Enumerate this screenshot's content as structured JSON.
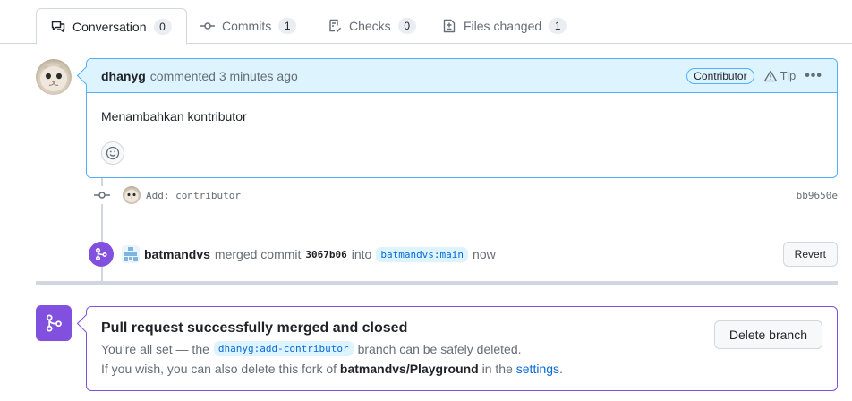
{
  "tabs": [
    {
      "label": "Conversation",
      "count": "0",
      "icon": "comment-discussion-icon"
    },
    {
      "label": "Commits",
      "count": "1",
      "icon": "git-commit-icon"
    },
    {
      "label": "Checks",
      "count": "0",
      "icon": "checklist-icon"
    },
    {
      "label": "Files changed",
      "count": "1",
      "icon": "file-diff-icon"
    }
  ],
  "comment": {
    "author": "dhanyg",
    "meta": "commented 3 minutes ago",
    "role_badge": "Contributor",
    "tip_label": "Tip",
    "body": "Menambahkan kontributor"
  },
  "commit": {
    "message": "Add: contributor",
    "sha": "bb9650e"
  },
  "merge_event": {
    "actor": "batmandvs",
    "action": "merged commit",
    "commit_sha": "3067b06",
    "into_word": "into",
    "target_branch": "batmandvs:main",
    "time": "now",
    "revert_label": "Revert"
  },
  "merged_panel": {
    "title": "Pull request successfully merged and closed",
    "line1_prefix": "You’re all set — the",
    "branch": "dhanyg:add-contributor",
    "line1_suffix": "branch can be safely deleted.",
    "line2_prefix": "If you wish, you can also delete this fork of",
    "repo": "batmandvs/Playground",
    "line2_middle": "in the",
    "settings_link": "settings",
    "line2_end": ".",
    "delete_button": "Delete branch"
  },
  "colors": {
    "accent_blue": "#0969da",
    "merged_purple": "#8250df",
    "comment_header_bg": "#ddf4ff"
  }
}
